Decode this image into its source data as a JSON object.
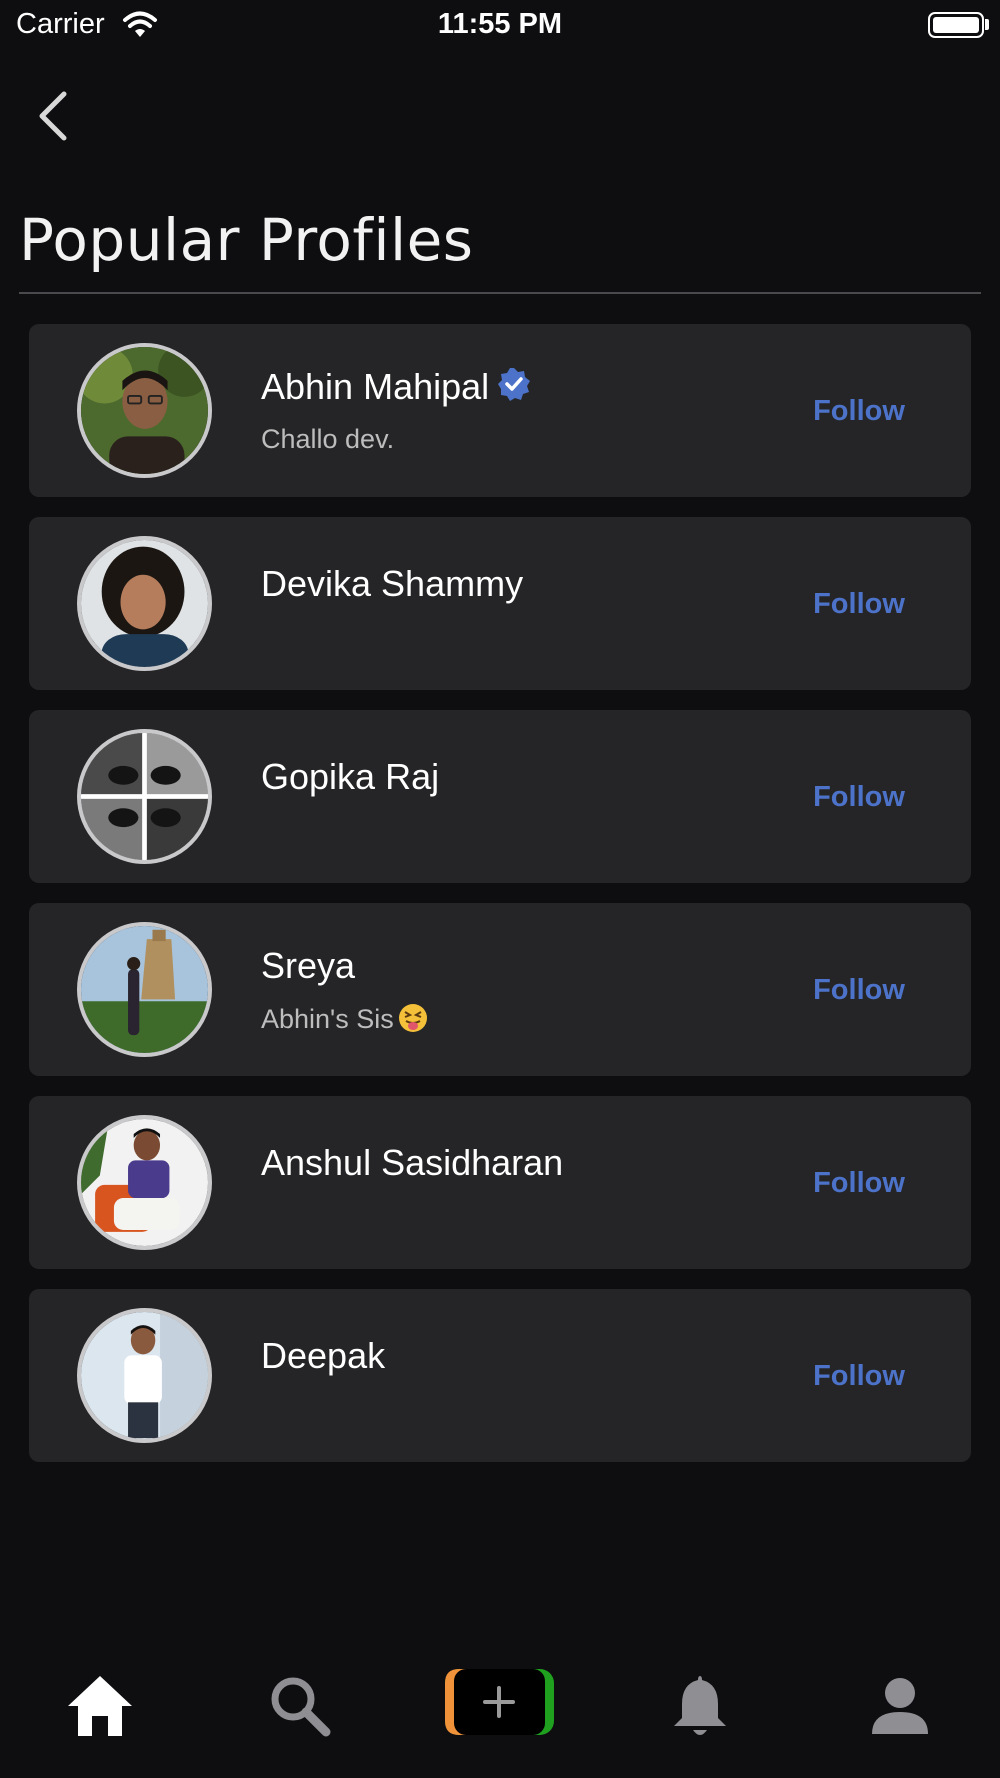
{
  "status_bar": {
    "carrier": "Carrier",
    "time": "11:55 PM"
  },
  "header": {
    "back_icon": "chevron-left-icon",
    "title": "Popular Profiles"
  },
  "profiles": [
    {
      "name": "Abhin Mahipal",
      "bio": "Challo dev.",
      "verified": true,
      "follow_label": "Follow"
    },
    {
      "name": "Devika Shammy",
      "bio": "",
      "verified": false,
      "follow_label": "Follow"
    },
    {
      "name": "Gopika Raj",
      "bio": "",
      "verified": false,
      "follow_label": "Follow"
    },
    {
      "name": "Sreya",
      "bio": "Abhin's Sis",
      "verified": false,
      "follow_label": "Follow"
    },
    {
      "name": "Anshul Sasidharan",
      "bio": "",
      "verified": false,
      "follow_label": "Follow"
    },
    {
      "name": "Deepak",
      "bio": "",
      "verified": false,
      "follow_label": "Follow"
    }
  ],
  "tab_bar": {
    "tabs": [
      {
        "icon": "home-icon",
        "active": true
      },
      {
        "icon": "search-icon",
        "active": false
      },
      {
        "icon": "plus-icon",
        "active": false
      },
      {
        "icon": "bell-icon",
        "active": false
      },
      {
        "icon": "person-icon",
        "active": false
      }
    ]
  },
  "colors": {
    "background": "#0e0e10",
    "card": "#252527",
    "follow": "#4c73c9",
    "verified": "#4c73c9",
    "create_left": "#f0923a",
    "create_right": "#1fa11f"
  }
}
